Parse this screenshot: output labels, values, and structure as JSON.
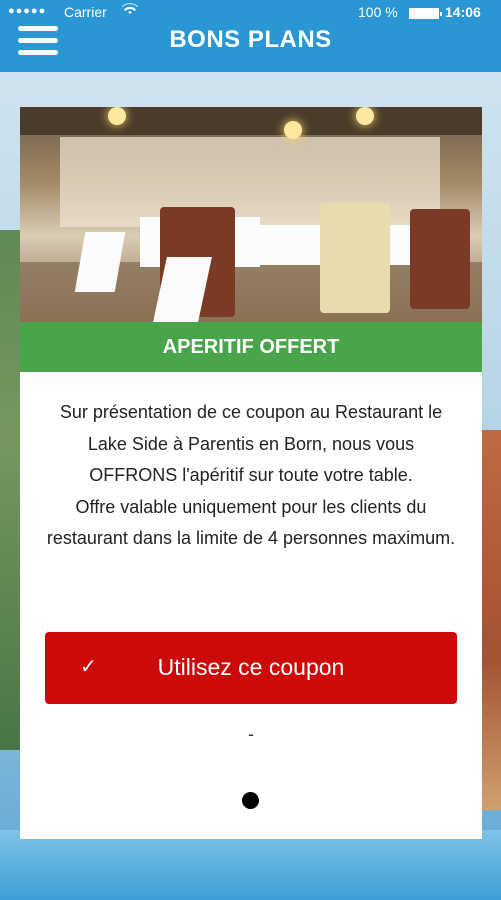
{
  "status_bar": {
    "dots": "●●●●●",
    "carrier": "Carrier",
    "wifi_icon": "wifi-icon",
    "battery_pct": "100 %",
    "time": "14:06"
  },
  "nav": {
    "title": "BONS PLANS",
    "menu_icon": "hamburger-menu-icon"
  },
  "offer": {
    "photo_alt": "restaurant-interior-photo",
    "banner": "APERITIF OFFERT",
    "description_lines": [
      "Sur présentation de ce coupon au Restaurant le Lake Side à Parentis en Born, nous vous OFFRONS l'apéritif sur toute votre table.",
      "Offre valable uniquement pour les clients du restaurant dans la limite de 4 personnes maximum."
    ],
    "button_label": "Utilisez ce coupon",
    "button_icon": "checkmark-icon",
    "separator": "-"
  },
  "colors": {
    "nav_bg": "#2a97d4",
    "banner_bg": "#4aa44a",
    "button_bg": "#cc0a0a"
  }
}
